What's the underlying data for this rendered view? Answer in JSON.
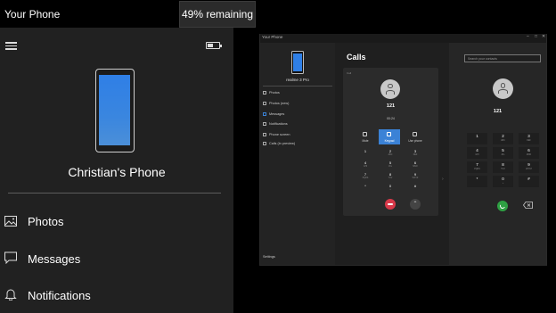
{
  "app": {
    "title": "Your Phone",
    "battery_tooltip": "49% remaining",
    "battery_level": 0.49
  },
  "phone": {
    "name": "Christian's Phone"
  },
  "nav": [
    {
      "label": "Photos",
      "icon": "photos-icon"
    },
    {
      "label": "Messages",
      "icon": "messages-icon"
    },
    {
      "label": "Notifications",
      "icon": "bell-icon"
    }
  ],
  "inner_window": {
    "title": "Your Phone",
    "controls": [
      "–",
      "□",
      "✕"
    ],
    "phone_name": "realme 3 Pro",
    "sidebar_items": [
      "Photos",
      "Photos (new)",
      "Messages",
      "Notifications",
      "Phone screen",
      "Calls (in preview)"
    ],
    "settings_label": "Settings",
    "calls_title": "Calls",
    "card_label": "Call",
    "card_number": "121",
    "card_timer": "00:24",
    "call_controls": [
      "Mute",
      "Keypad",
      "Use phone"
    ],
    "card_keypad": [
      {
        "d": "1",
        "s": ""
      },
      {
        "d": "2",
        "s": "ABC"
      },
      {
        "d": "3",
        "s": "DEF"
      },
      {
        "d": "4",
        "s": "GHI"
      },
      {
        "d": "5",
        "s": "JKL"
      },
      {
        "d": "6",
        "s": "MNO"
      },
      {
        "d": "7",
        "s": "PQRS"
      },
      {
        "d": "8",
        "s": "TUV"
      },
      {
        "d": "9",
        "s": "WXYZ"
      },
      {
        "d": "*",
        "s": ""
      },
      {
        "d": "0",
        "s": "+"
      },
      {
        "d": "#",
        "s": ""
      }
    ],
    "collapse_glyph": "⌃",
    "caret_glyph": "›",
    "search_placeholder": "Search your contacts",
    "dial_number": "121",
    "dial_keypad": [
      {
        "d": "1",
        "s": ""
      },
      {
        "d": "2",
        "s": "ABC"
      },
      {
        "d": "3",
        "s": "DEF"
      },
      {
        "d": "4",
        "s": "GHI"
      },
      {
        "d": "5",
        "s": "JKL"
      },
      {
        "d": "6",
        "s": "MNO"
      },
      {
        "d": "7",
        "s": "PQRS"
      },
      {
        "d": "8",
        "s": "TUV"
      },
      {
        "d": "9",
        "s": "WXYZ"
      },
      {
        "d": "*",
        "s": ""
      },
      {
        "d": "0",
        "s": "+"
      },
      {
        "d": "#",
        "s": ""
      }
    ]
  },
  "colors": {
    "accent": "#3b82d6",
    "end_call": "#d9394a",
    "call": "#2ea043"
  }
}
